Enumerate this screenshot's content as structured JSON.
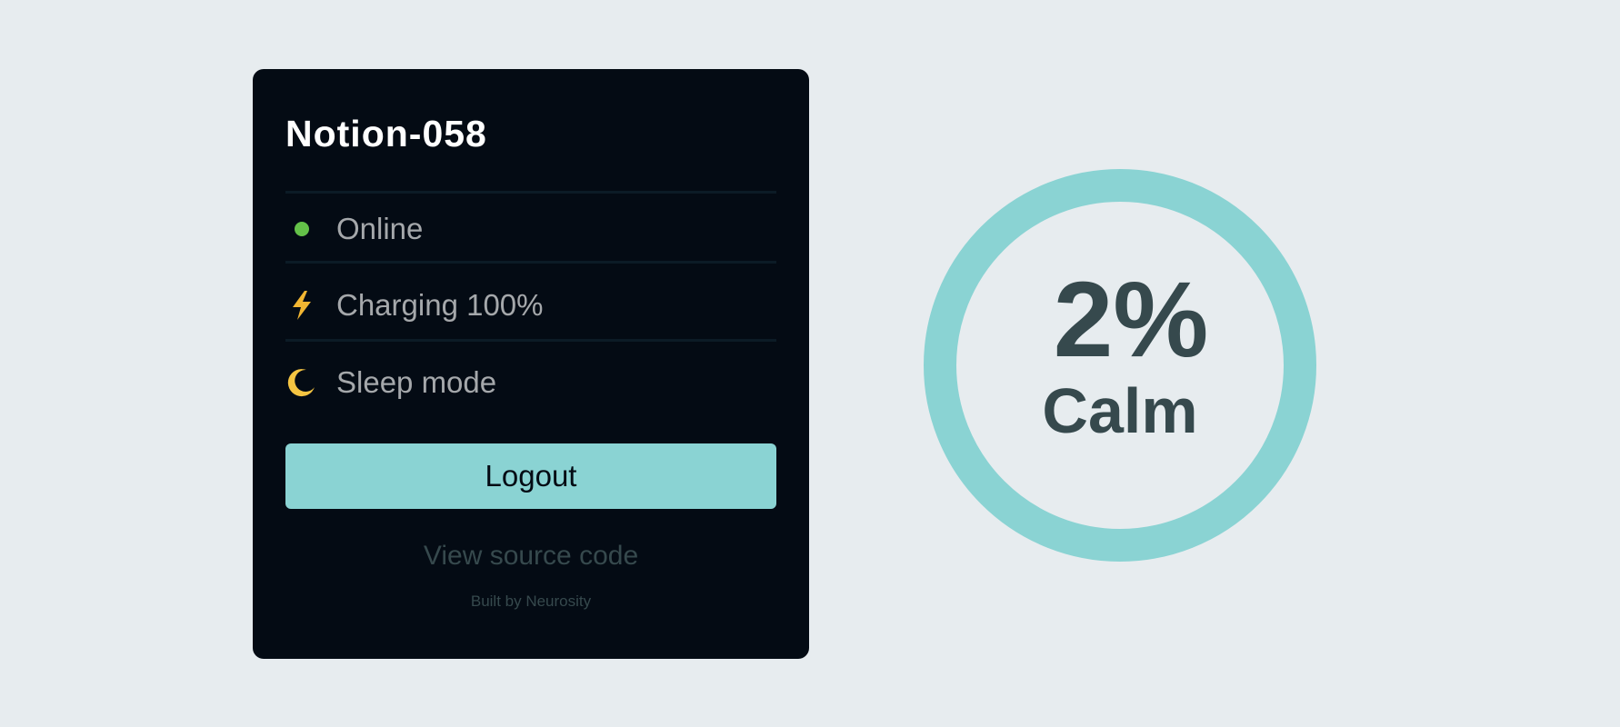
{
  "device": {
    "name": "Notion-058"
  },
  "status": {
    "online_label": "Online",
    "charging_icon": "⚡",
    "charging_label": "Charging 100%",
    "sleep_icon": "🌙",
    "sleep_label": "Sleep mode"
  },
  "actions": {
    "logout_label": "Logout",
    "source_label": "View source code",
    "built_by": "Built by Neurosity"
  },
  "metric": {
    "value": "2%",
    "label": "Calm"
  },
  "colors": {
    "background": "#e7ecef",
    "card": "#040b14",
    "accent": "#8ad3d3",
    "online": "#64c149",
    "text_dark": "#36494d",
    "text_muted": "#a5a8ab"
  }
}
